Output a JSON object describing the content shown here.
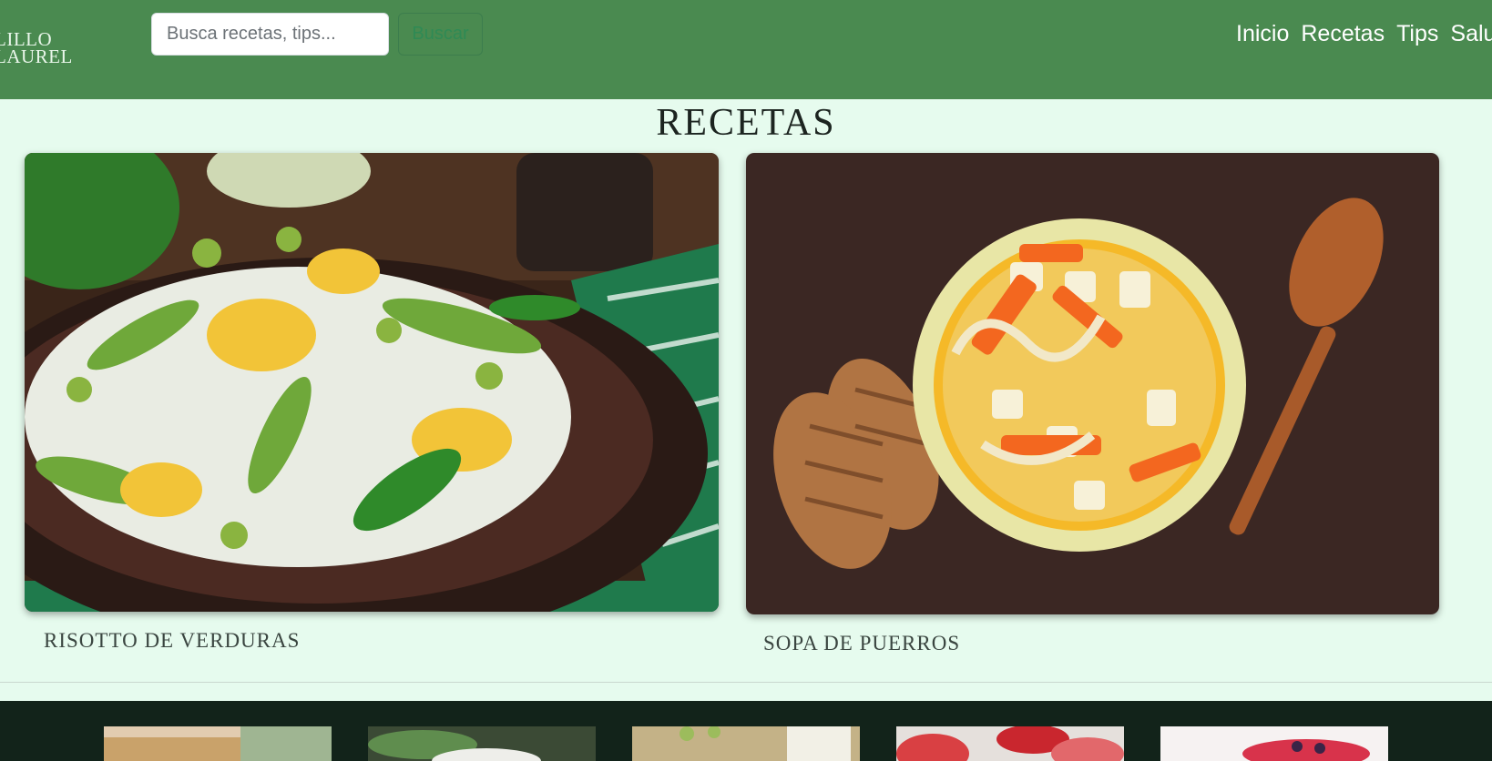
{
  "header": {
    "brand": "LILLO\nLAUREL",
    "search": {
      "placeholder": "Busca recetas, tips...",
      "value": ""
    },
    "search_button": "Buscar",
    "nav": [
      {
        "label": "Inicio"
      },
      {
        "label": "Recetas"
      },
      {
        "label": "Tips"
      },
      {
        "label": "Salu"
      }
    ]
  },
  "main": {
    "title": "RECETAS",
    "cards": [
      {
        "title": "RISOTTO DE VERDURAS",
        "image": "risotto-photo"
      },
      {
        "title": "SOPA DE PUERROS",
        "image": "soup-photo"
      }
    ]
  },
  "footer": {
    "thumbnails": [
      "bread-photo",
      "salad-photo",
      "drink-photo",
      "fruit-photo",
      "dessert-photo"
    ]
  },
  "colors": {
    "navbar": "#4a8a50",
    "page_background": "#e6fbee",
    "footer": "#12231a"
  }
}
